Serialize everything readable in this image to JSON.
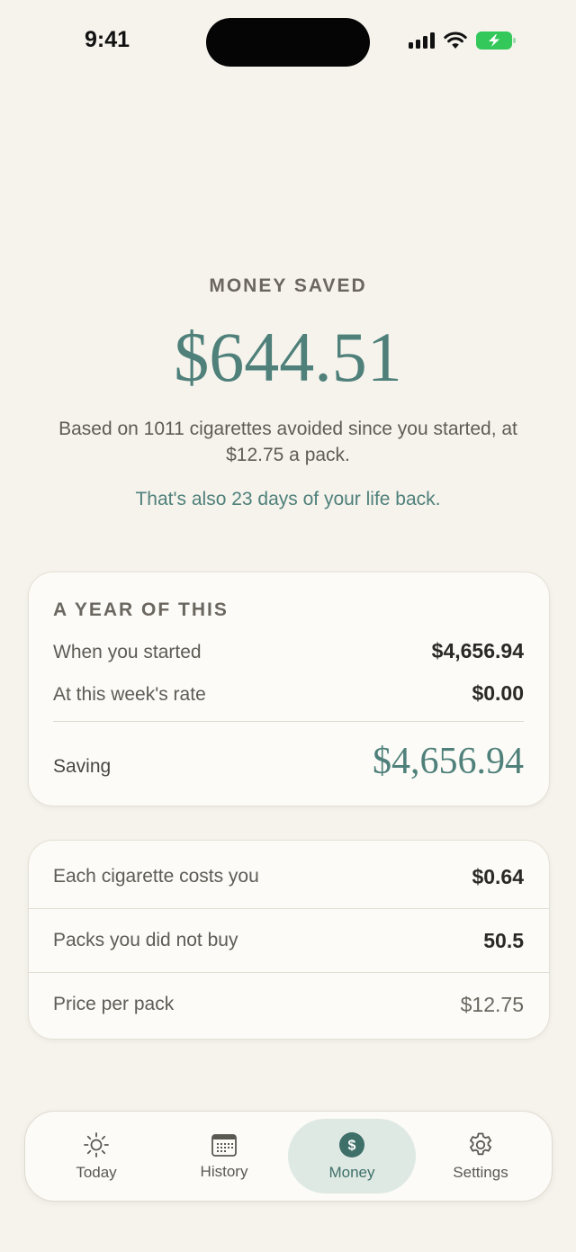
{
  "status_bar": {
    "time": "9:41"
  },
  "hero": {
    "eyebrow": "MONEY SAVED",
    "amount": "$644.51",
    "description": "Based on 1011 cigarettes avoided since you started, at $12.75 a pack.",
    "life_back": "That's also 23 days of your life back."
  },
  "year_card": {
    "title": "A YEAR OF THIS",
    "rows": [
      {
        "label": "When you started",
        "value": "$4,656.94"
      },
      {
        "label": "At this week's rate",
        "value": "$0.00"
      }
    ],
    "saving_label": "Saving",
    "saving_value": "$4,656.94"
  },
  "stats_card": {
    "rows": [
      {
        "label": "Each cigarette costs you",
        "value": "$0.64"
      },
      {
        "label": "Packs you did not buy",
        "value": "50.5"
      },
      {
        "label": "Price per pack",
        "value": "$12.75"
      }
    ]
  },
  "tabbar": {
    "tabs": [
      {
        "label": "Today",
        "icon": "sun-icon"
      },
      {
        "label": "History",
        "icon": "calendar-icon"
      },
      {
        "label": "Money",
        "icon": "dollar-icon",
        "active": true
      },
      {
        "label": "Settings",
        "icon": "gear-icon"
      }
    ]
  },
  "colors": {
    "accent": "#4f807a",
    "background": "#f6f3ed",
    "active_tab_bg": "#dfe9e4",
    "battery_green": "#34c759"
  }
}
